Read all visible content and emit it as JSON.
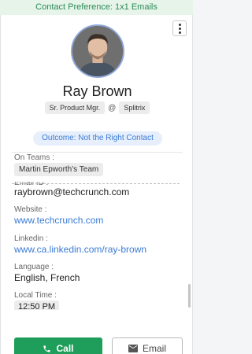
{
  "header": {
    "contact_preference": "Contact Preference: 1x1 Emails"
  },
  "profile": {
    "name": "Ray Brown",
    "title": "Sr. Product Mgr.",
    "at": "@",
    "company": "Splitrix",
    "outcome": "Outcome: Not the Right Contact"
  },
  "details": {
    "teams_label": "On Teams :",
    "team": "Martin Epworth's Team",
    "email_label": "Email ID :",
    "email": "raybrown@techcrunch.com",
    "website_label": "Website :",
    "website": "www.techcrunch.com",
    "linkedin_label": "Linkedin :",
    "linkedin": "www.ca.linkedin.com/ray-brown",
    "language_label": "Language :",
    "language": "English, French",
    "localtime_label": "Local Time :",
    "localtime": "12:50 PM"
  },
  "actions": {
    "call_label": "Call",
    "email_label": "Email"
  },
  "colors": {
    "accent_green": "#1e9e5a",
    "link_blue": "#3a7bd5",
    "pref_bg": "#e6f4ea"
  },
  "icons": {
    "menu": "kebab-menu-icon",
    "call": "phone-icon",
    "email": "envelope-icon"
  }
}
